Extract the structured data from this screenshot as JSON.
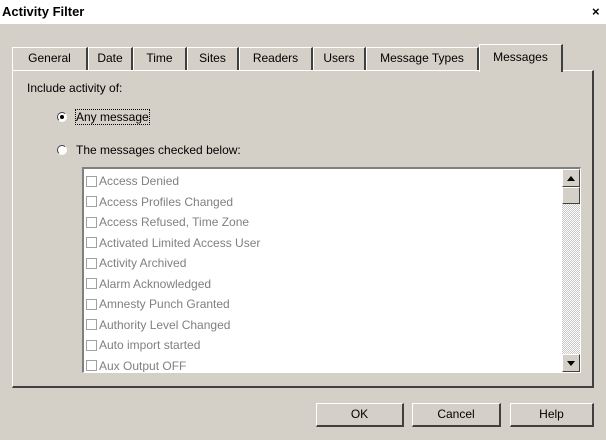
{
  "window": {
    "title": "Activity Filter",
    "close_glyph": "×"
  },
  "tabs": [
    {
      "label": "General",
      "active": false
    },
    {
      "label": "Date",
      "active": false
    },
    {
      "label": "Time",
      "active": false
    },
    {
      "label": "Sites",
      "active": false
    },
    {
      "label": "Readers",
      "active": false
    },
    {
      "label": "Users",
      "active": false
    },
    {
      "label": "Message Types",
      "active": false
    },
    {
      "label": "Messages",
      "active": true
    }
  ],
  "filter": {
    "include_label": "Include activity of:",
    "option_any": "Any message",
    "option_checked": "The messages checked below:",
    "selected": "Any message"
  },
  "messages": [
    {
      "label": "Access Denied",
      "checked": false
    },
    {
      "label": "Access Profiles Changed",
      "checked": false
    },
    {
      "label": "Access Refused, Time Zone",
      "checked": false
    },
    {
      "label": "Activated Limited Access User",
      "checked": false
    },
    {
      "label": "Activity Archived",
      "checked": false
    },
    {
      "label": "Alarm Acknowledged",
      "checked": false
    },
    {
      "label": "Amnesty Punch Granted",
      "checked": false
    },
    {
      "label": "Authority Level Changed",
      "checked": false
    },
    {
      "label": "Auto import started",
      "checked": false
    },
    {
      "label": "Aux Output OFF",
      "checked": false
    }
  ],
  "buttons": {
    "ok": "OK",
    "cancel": "Cancel",
    "help": "Help"
  },
  "colors": {
    "face": "#d4d0c8",
    "disabled_text": "#808080",
    "highlight": "#ffffff",
    "shadow": "#404040"
  }
}
